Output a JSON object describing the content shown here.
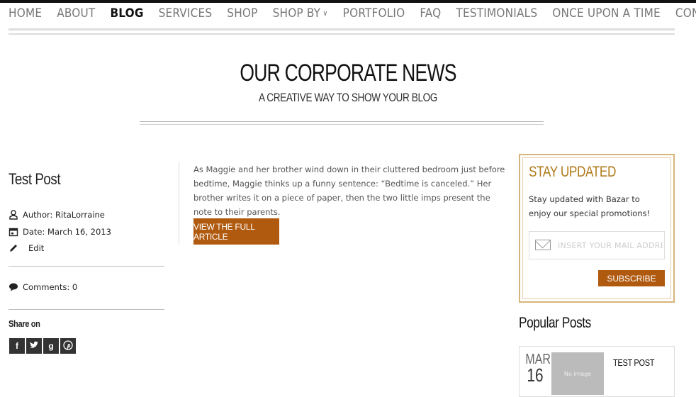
{
  "nav": {
    "items": [
      {
        "label": "HOME"
      },
      {
        "label": "ABOUT"
      },
      {
        "label": "BLOG"
      },
      {
        "label": "SERVICES"
      },
      {
        "label": "SHOP"
      },
      {
        "label": "SHOP BY"
      },
      {
        "label": "PORTFOLIO"
      },
      {
        "label": "FAQ"
      },
      {
        "label": "TESTIMONIALS"
      },
      {
        "label": "ONCE UPON A TIME"
      },
      {
        "label": "CONTACT"
      }
    ],
    "active": "BLOG",
    "dropdown_icon": "chevron-down-icon"
  },
  "hero": {
    "title": "OUR CORPORATE NEWS",
    "subtitle": "A CREATIVE WAY TO SHOW YOUR BLOG"
  },
  "post": {
    "title": "Test Post",
    "author": "Author: RitaLorraine",
    "date": "Date: March 16, 2013",
    "edit": "Edit",
    "comments": "Comments: 0",
    "share_label": "Share on",
    "share_buttons": [
      "f",
      "t",
      "g",
      "p"
    ],
    "excerpt": "As Maggie and her brother wind down in their cluttered bedroom just before bedtime, Maggie thinks up a funny sentence: “Bedtime is canceled.” Her brother writes it on a piece of paper, then the two little imps present the note to their parents.",
    "read_more": "VIEW THE FULL ARTICLE"
  },
  "newsletter": {
    "title": "STAY UPDATED",
    "text": "Stay updated with Bazar to enjoy our special promotions!",
    "placeholder": "INSERT YOUR MAIL ADDRESS",
    "button": "SUBSCRIBE"
  },
  "popular": {
    "title": "Popular Posts",
    "items": [
      {
        "month": "MAR",
        "day": "16",
        "thumb_text": "No image",
        "title": "TEST POST"
      }
    ]
  },
  "colors": {
    "accent": "#b05a0f",
    "box_border": "#d7b47a",
    "title_gold": "#b07a1a"
  }
}
